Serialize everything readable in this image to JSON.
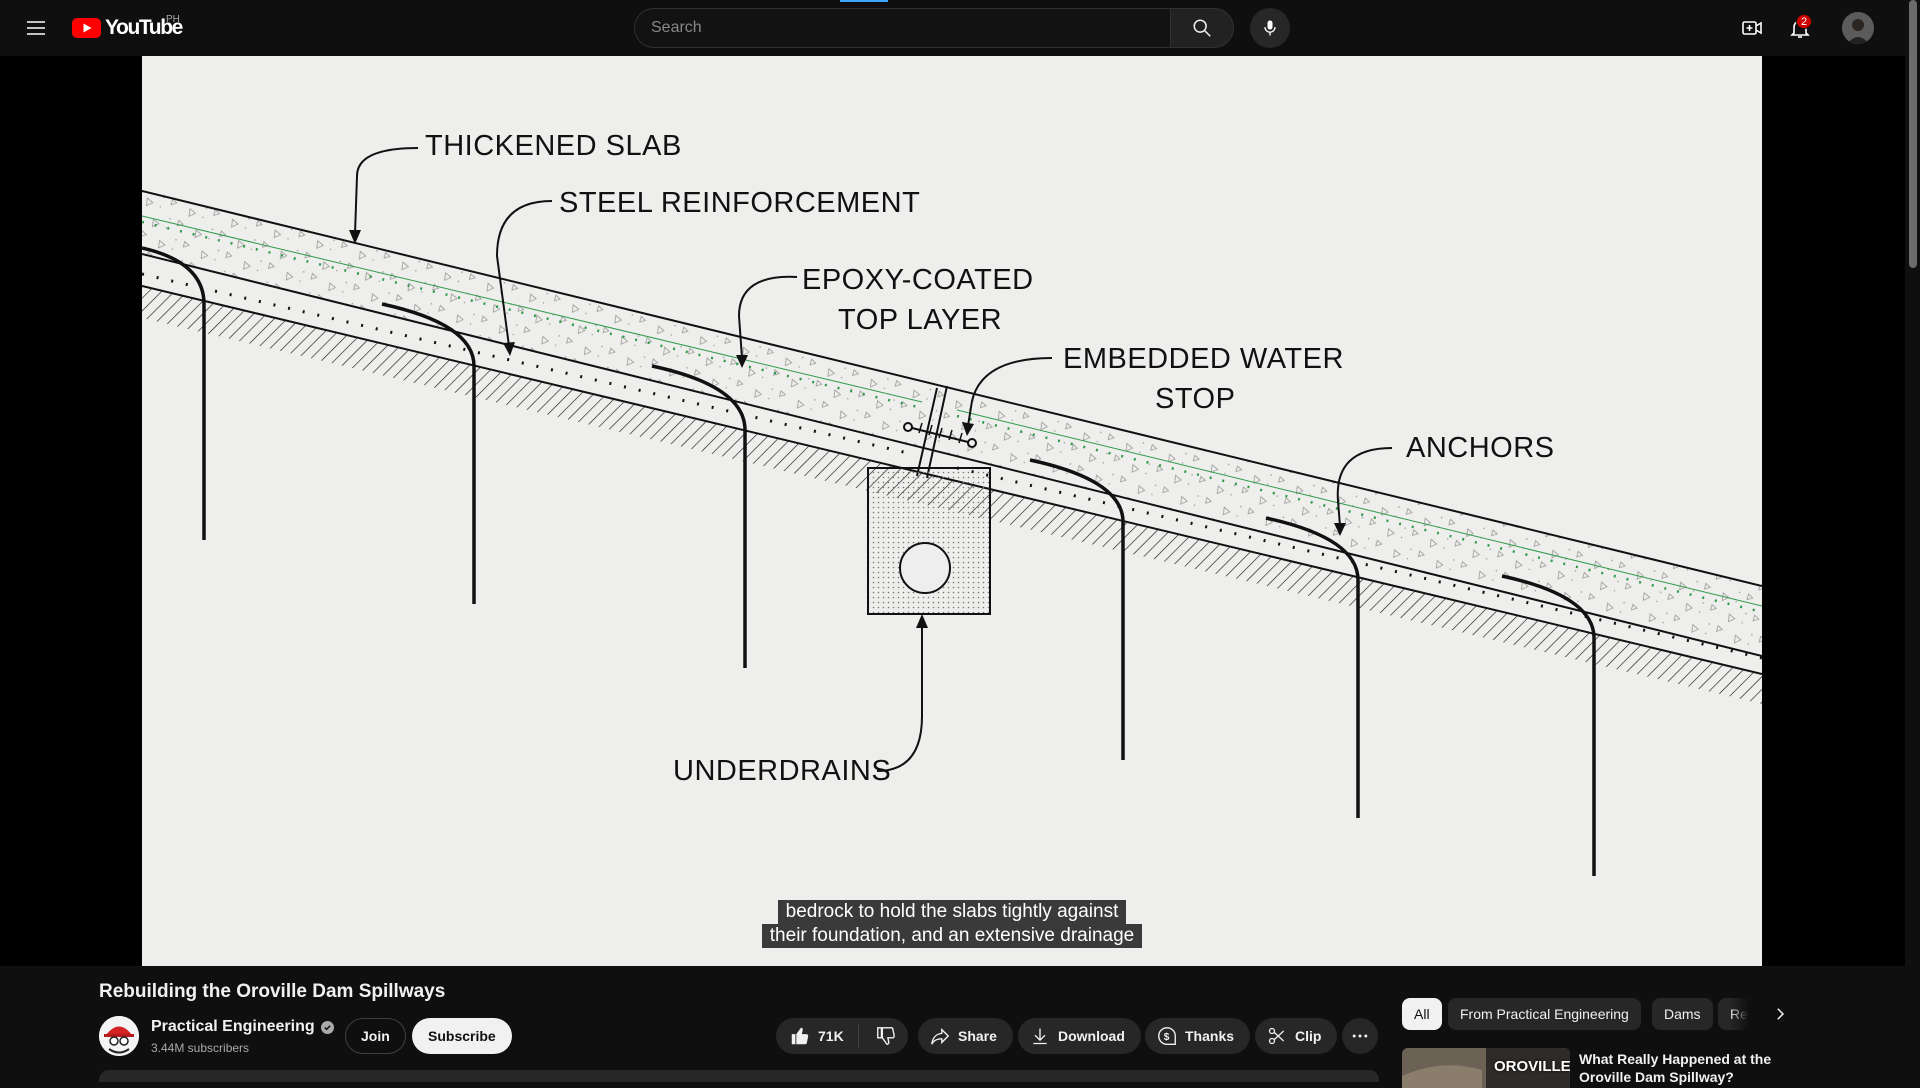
{
  "masthead": {
    "logo_text": "YouTube",
    "country_code": "PH",
    "search_placeholder": "Search",
    "notification_count": "2"
  },
  "video": {
    "diagram_labels": {
      "thickened_slab": "THICKENED SLAB",
      "steel_reinforcement": "STEEL REINFORCEMENT",
      "epoxy_line1": "EPOXY-COATED",
      "epoxy_line2": "TOP LAYER",
      "water_stop_line1": "EMBEDDED WATER",
      "water_stop_line2": "STOP",
      "anchors": "ANCHORS",
      "underdrains": "UNDERDRAINS"
    },
    "caption_lines": [
      "bedrock to hold the slabs tightly against",
      "their foundation, and an extensive drainage"
    ],
    "colors": {
      "epoxy_layer": "#2e9a4a",
      "background": "#eeeeec"
    }
  },
  "watch": {
    "title": "Rebuilding the Oroville Dam Spillways",
    "channel_name": "Practical Engineering",
    "subscribers": "3.44M subscribers",
    "join_label": "Join",
    "subscribe_label": "Subscribe",
    "like_count": "71K",
    "share_label": "Share",
    "download_label": "Download",
    "thanks_label": "Thanks",
    "clip_label": "Clip"
  },
  "sidebar": {
    "chips": [
      "All",
      "From Practical Engineering",
      "Dams",
      "Related"
    ],
    "recommendation": {
      "thumb_text": "OROVILLE",
      "title": "What Really Happened at the Oroville Dam Spillway?"
    }
  }
}
